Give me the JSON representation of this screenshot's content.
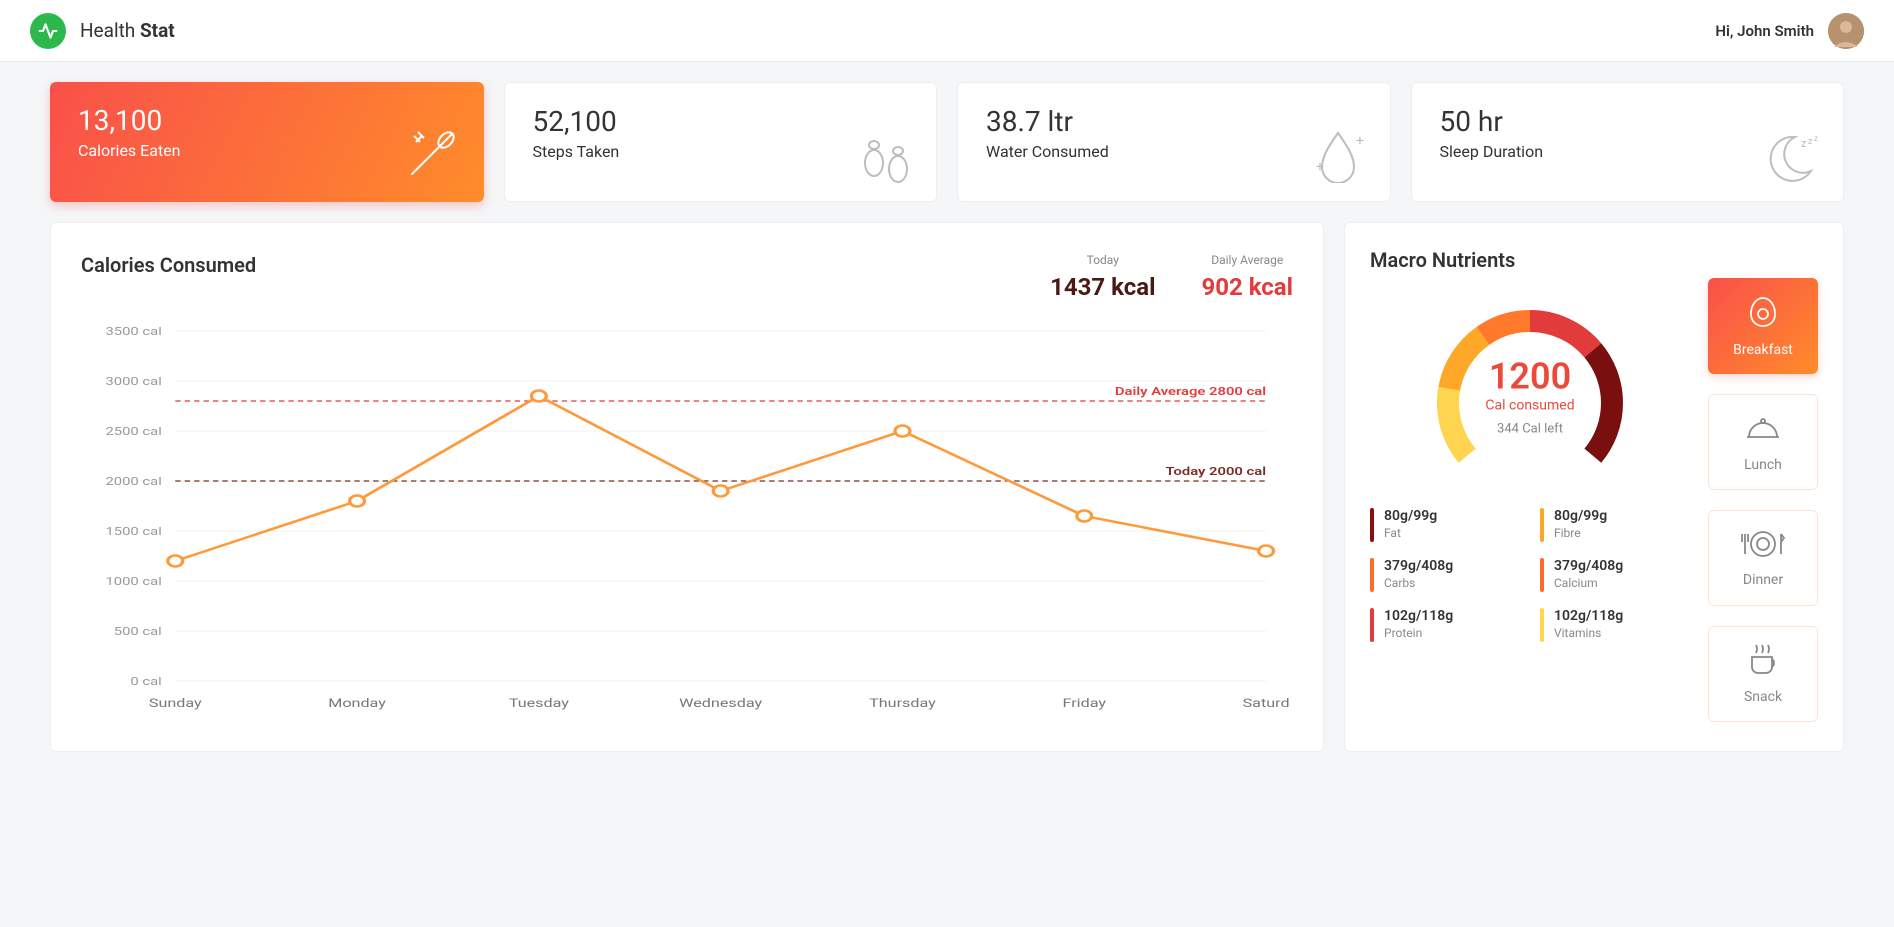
{
  "header": {
    "app_name_light": "Health ",
    "app_name_bold": "Stat",
    "greeting": "Hi, John Smith"
  },
  "stats": [
    {
      "value": "13,100",
      "label": "Calories Eaten",
      "active": true,
      "icon": "utensils"
    },
    {
      "value": "52,100",
      "label": "Steps Taken",
      "active": false,
      "icon": "footprints"
    },
    {
      "value": "38.7 ltr",
      "label": "Water Consumed",
      "active": false,
      "icon": "water-drop"
    },
    {
      "value": "50 hr",
      "label": "Sleep Duration",
      "active": false,
      "icon": "moon"
    }
  ],
  "chart": {
    "title": "Calories Consumed",
    "today_label": "Today",
    "today_value": "1437 kcal",
    "avg_label": "Daily Average",
    "avg_value": "902 kcal",
    "ref_avg_label": "Daily Average 2800 cal",
    "ref_today_label": "Today 2000 cal"
  },
  "chart_data": {
    "type": "line",
    "categories": [
      "Sunday",
      "Monday",
      "Tuesday",
      "Wednesday",
      "Thursday",
      "Friday",
      "Saturd"
    ],
    "values": [
      1200,
      1800,
      2850,
      1900,
      2500,
      1650,
      1300
    ],
    "y_ticks": [
      0,
      500,
      1000,
      1500,
      2000,
      2500,
      3000,
      3500
    ],
    "y_tick_labels": [
      "0 cal",
      "500 cal",
      "1000 cal",
      "1500 cal",
      "2000 cal",
      "2500 cal",
      "3000 cal",
      "3500 cal"
    ],
    "ylim": [
      0,
      3500
    ],
    "reference_lines": [
      {
        "value": 2800,
        "label": "Daily Average 2800 cal",
        "color": "#e23b3b"
      },
      {
        "value": 2000,
        "label": "Today 2000 cal",
        "color": "#7a2b22"
      }
    ]
  },
  "macro": {
    "title": "Macro Nutrients",
    "gauge_value": "1200",
    "gauge_sub": "Cal consumed",
    "gauge_left": "344 Cal left",
    "nutrients": [
      {
        "value": "80g/99g",
        "name": "Fat",
        "color": "#8a0f0f"
      },
      {
        "value": "80g/99g",
        "name": "Fibre",
        "color": "#f9a825"
      },
      {
        "value": "379g/408g",
        "name": "Carbs",
        "color": "#ff6a2a"
      },
      {
        "value": "379g/408g",
        "name": "Calcium",
        "color": "#ff6a2a"
      },
      {
        "value": "102g/118g",
        "name": "Protein",
        "color": "#e23b3b"
      },
      {
        "value": "102g/118g",
        "name": "Vitamins",
        "color": "#ffd54f"
      }
    ],
    "meals": [
      {
        "label": "Breakfast",
        "active": true,
        "icon": "egg"
      },
      {
        "label": "Lunch",
        "active": false,
        "icon": "cloche"
      },
      {
        "label": "Dinner",
        "active": false,
        "icon": "plate"
      },
      {
        "label": "Snack",
        "active": false,
        "icon": "cup"
      }
    ]
  }
}
